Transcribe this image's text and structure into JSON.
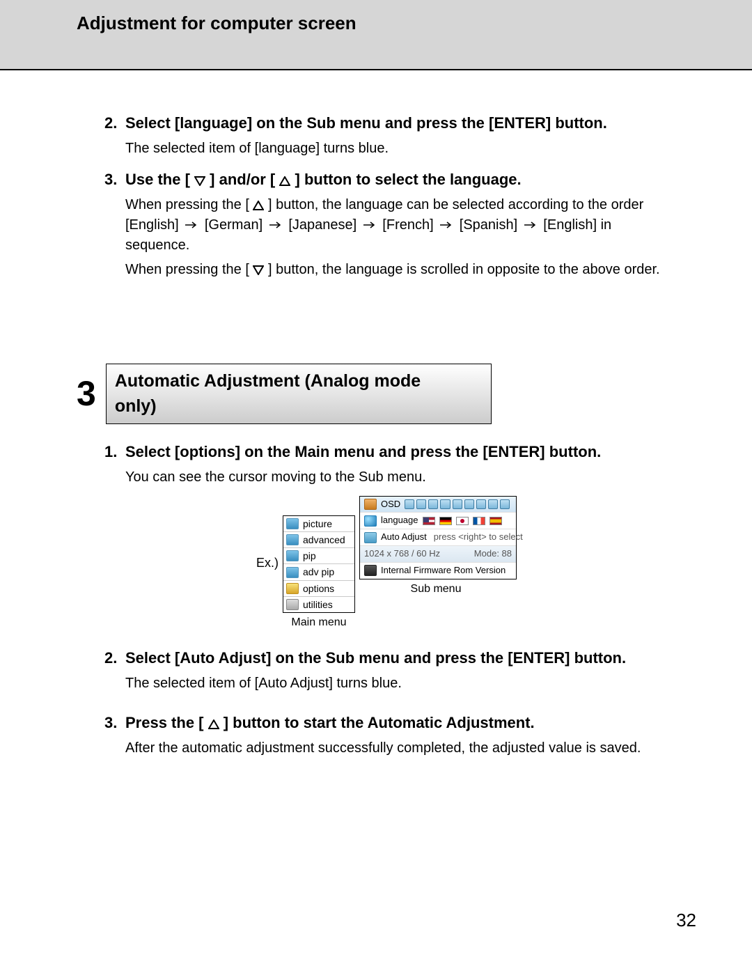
{
  "header": {
    "title": "Adjustment for computer screen"
  },
  "steps_top": {
    "s2": {
      "num": "2.",
      "head_a": "Select [",
      "head_b": "language",
      "head_c": "] on the Sub menu and press the [ENTER] button.",
      "desc_a": "The selected item of [",
      "desc_b": "language",
      "desc_c": "] turns blue."
    },
    "s3": {
      "num": "3.",
      "head_a": "Use the [ ",
      "head_b": " ] and/or [ ",
      "head_c": " ] button to select the language.",
      "desc1_a": "When pressing the [ ",
      "desc1_b": " ] button, the language can be selected according to the order [English] ",
      "desc1_c": " [German] ",
      "desc1_d": " [Japanese] ",
      "desc1_e": " [French] ",
      "desc1_f": " [Spanish] ",
      "desc1_g": " [English] in sequence.",
      "desc2_a": "When pressing the [ ",
      "desc2_b": " ] button, the language is scrolled in opposite to the above order."
    }
  },
  "section": {
    "num": "3",
    "title": "Automatic Adjustment (Analog mode only)"
  },
  "steps_sec": {
    "s1": {
      "num": "1.",
      "head_a": "Select [",
      "head_b": "options",
      "head_c": "] on the Main menu and press the [ENTER] button.",
      "desc": "You can see the cursor moving to the Sub menu."
    },
    "s2": {
      "num": "2.",
      "head_a": "Select [",
      "head_b": "Auto Adjust",
      "head_c": "] on the Sub menu and press the [ENTER] button.",
      "desc_a": "The selected item of [",
      "desc_b": "Auto Adjust",
      "desc_c": "] turns blue."
    },
    "s3": {
      "num": "3.",
      "head_a": "Press the [ ",
      "head_b": " ] button to start the Automatic Adjustment.",
      "desc": "After the automatic adjustment successfully completed, the adjusted value is saved."
    }
  },
  "osd": {
    "ex": "Ex.)",
    "main_caption": "Main menu",
    "sub_caption": "Sub menu",
    "main_items": [
      "picture",
      "advanced",
      "pip",
      "adv pip",
      "options",
      "utilities"
    ],
    "top_label": "OSD",
    "lang_label": "language",
    "auto_label": "Auto Adjust",
    "auto_hint": "press  <right>  to  select",
    "res": "1024  x  768  /  60  Hz",
    "mode": "Mode:  88",
    "firmware": "Internal  Firmware  Rom Version"
  },
  "page_number": "32"
}
